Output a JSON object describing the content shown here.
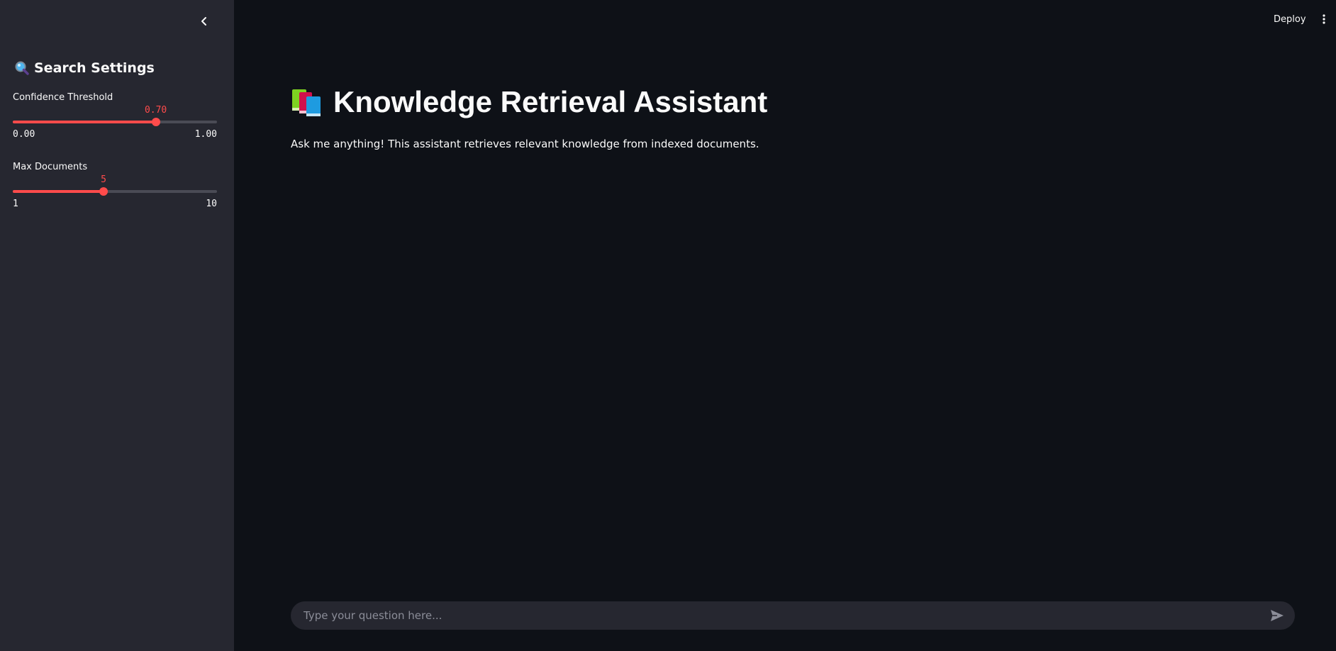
{
  "sidebar": {
    "collapse_icon": "chevron-left-icon",
    "heading": {
      "icon": "magnifying-glass-icon",
      "label": "Search Settings"
    },
    "sliders": [
      {
        "label": "Confidence Threshold",
        "value": 0.7,
        "value_text": "0.70",
        "min_text": "0.00",
        "max_text": "1.00",
        "fraction": 0.7
      },
      {
        "label": "Max Documents",
        "value": 5,
        "value_text": "5",
        "min_text": "1",
        "max_text": "10",
        "fraction": 0.4444
      }
    ]
  },
  "header": {
    "deploy_label": "Deploy",
    "menu_icon": "vertical-ellipsis-icon"
  },
  "main": {
    "title_icon": "books-icon",
    "title": "Knowledge Retrieval Assistant",
    "subtitle": "Ask me anything! This assistant retrieves relevant knowledge from indexed documents."
  },
  "chat": {
    "placeholder": "Type your question here...",
    "value": "",
    "send_icon": "send-arrow-icon"
  },
  "colors": {
    "accent": "#ff4b4b",
    "background": "#0e1117",
    "sidebar": "#262730",
    "text": "#fafafa"
  }
}
